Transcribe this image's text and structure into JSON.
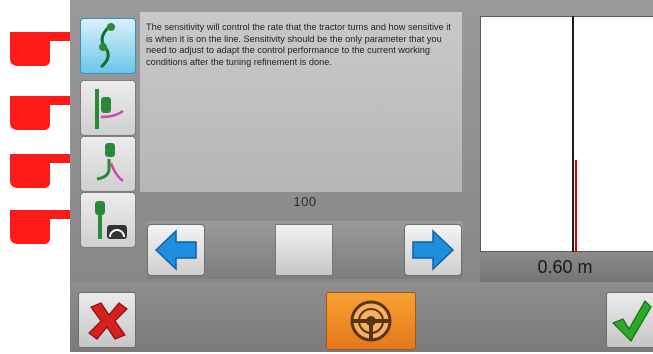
{
  "description": {
    "text": "The sensitivity will control the rate that the tractor turns and how sensitive it is when it is on the line. Sensitivity should be the only parameter that you need to adjust to adapt the control performance to the current working conditions after the tuning refinement is done."
  },
  "slider": {
    "value_label": "100"
  },
  "graph": {
    "offset_label": "0.60 m"
  },
  "mode_buttons": [
    {
      "icon": "sensitivity-icon",
      "active": true
    },
    {
      "icon": "tractor-line-approach-icon",
      "active": false
    },
    {
      "icon": "tractor-line-acquire-icon",
      "active": false
    },
    {
      "icon": "tractor-speed-gauge-icon",
      "active": false
    }
  ],
  "colors": {
    "pointer_hand": "#ff1a1a",
    "active_button": "#6cc6ea",
    "arrow_blue": "#1f8fe0",
    "steer_orange": "#f28c28",
    "graph_line": "#d80000",
    "ok_green": "#2aa82a",
    "cancel_red": "#d62020"
  }
}
